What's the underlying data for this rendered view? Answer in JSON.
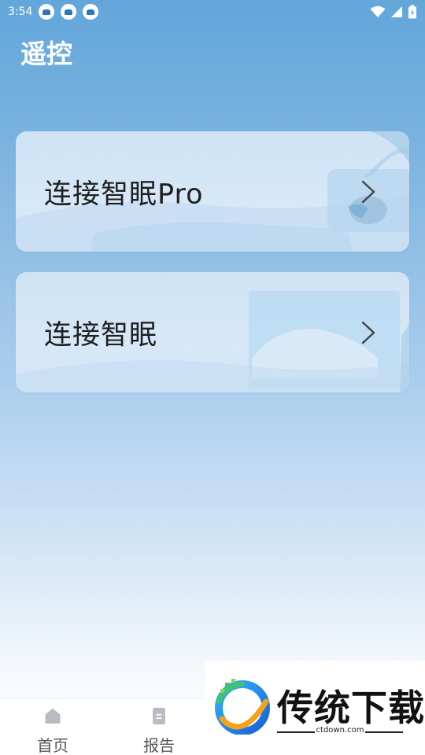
{
  "status_bar": {
    "time": "3:54",
    "notification_icons": [
      "app-notification-icon",
      "app-notification-icon",
      "app-notification-icon"
    ],
    "right_icons": [
      "wifi-icon",
      "signal-icon",
      "battery-charging-icon"
    ]
  },
  "header": {
    "title": "遥控"
  },
  "cards": [
    {
      "label": "连接智眠Pro",
      "icon": "chevron-right-icon"
    },
    {
      "label": "连接智眠",
      "icon": "chevron-right-icon"
    }
  ],
  "bottom_nav": {
    "items": [
      {
        "label": "首页",
        "icon": "home-icon"
      },
      {
        "label": "报告",
        "icon": "report-icon"
      }
    ]
  },
  "watermark": {
    "text": "传统下载",
    "url": "ctdown.com"
  },
  "colors": {
    "background_top": "#62a6da",
    "background_bottom": "#ffffff",
    "card_bg": "#d3e6f6",
    "text_dark": "#1f1f1f",
    "nav_label": "#555555"
  }
}
